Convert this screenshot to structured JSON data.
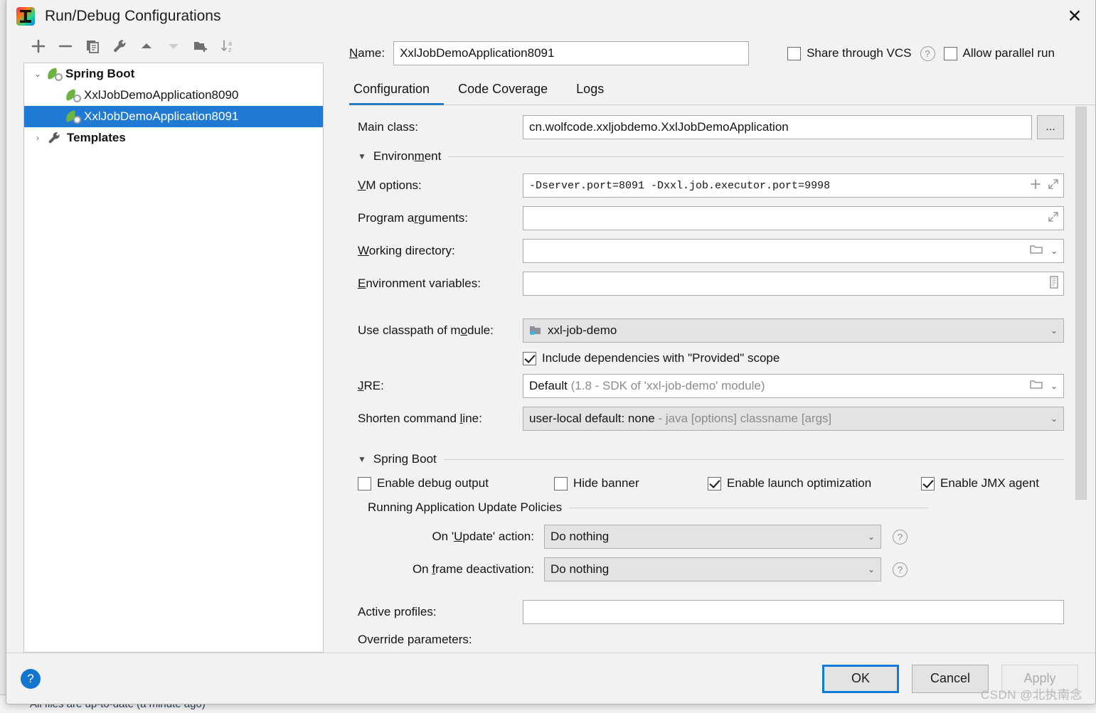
{
  "window": {
    "title": "Run/Debug Configurations",
    "app_icon": "intellij-idea-icon",
    "close_icon": "✕"
  },
  "tree_toolbar": {
    "buttons": [
      {
        "name": "add-configuration-button",
        "icon": "plus-icon",
        "enabled": true
      },
      {
        "name": "remove-configuration-button",
        "icon": "minus-icon",
        "enabled": true
      },
      {
        "name": "copy-configuration-button",
        "icon": "copy-icon",
        "enabled": true
      },
      {
        "name": "edit-templates-button",
        "icon": "wrench-icon",
        "enabled": true
      },
      {
        "name": "move-up-button",
        "icon": "arrow-up-icon",
        "enabled": true
      },
      {
        "name": "move-down-button",
        "icon": "arrow-down-icon",
        "enabled": false
      },
      {
        "name": "new-folder-button",
        "icon": "folder-add-icon",
        "enabled": true
      },
      {
        "name": "sort-alphabetically-button",
        "icon": "sort-az-icon",
        "enabled": true
      }
    ]
  },
  "tree": {
    "nodes": [
      {
        "label": "Spring Boot",
        "icon": "spring-boot-icon",
        "type": "group",
        "expanded": true,
        "twisty": "⌄",
        "selected": false
      },
      {
        "label": "XxlJobDemoApplication8090",
        "icon": "spring-boot-icon",
        "type": "leaf",
        "selected": false
      },
      {
        "label": "XxlJobDemoApplication8091",
        "icon": "spring-boot-icon",
        "type": "leaf",
        "selected": true
      },
      {
        "label": "Templates",
        "icon": "wrench-icon",
        "type": "group",
        "expanded": false,
        "twisty": "›",
        "selected": false
      }
    ]
  },
  "header": {
    "name_label": "Name:",
    "name_value": "XxlJobDemoApplication8091",
    "share_vcs_label": "Share through VCS",
    "share_vcs_checked": false,
    "share_vcs_help": "?",
    "allow_parallel_label": "Allow parallel run",
    "allow_parallel_checked": false
  },
  "tabs": [
    {
      "label": "Configuration",
      "active": true
    },
    {
      "label": "Code Coverage",
      "active": false
    },
    {
      "label": "Logs",
      "active": false
    }
  ],
  "form": {
    "main_class_label": "Main class:",
    "main_class_value": "cn.wolfcode.xxljobdemo.XxlJobDemoApplication",
    "main_class_browse": "...",
    "environment_section": "Environment",
    "vm_options_label": "VM options:",
    "vm_options_value": "-Dserver.port=8091 -Dxxl.job.executor.port=9998",
    "program_arguments_label": "Program arguments:",
    "program_arguments_value": "",
    "working_directory_label": "Working directory:",
    "working_directory_value": "",
    "environment_variables_label": "Environment variables:",
    "environment_variables_value": "",
    "classpath_module_label": "Use classpath of module:",
    "classpath_module_value": "xxl-job-demo",
    "include_provided_label": "Include dependencies with \"Provided\" scope",
    "include_provided_checked": true,
    "jre_label": "JRE:",
    "jre_value": "Default",
    "jre_value_hint": "(1.8 - SDK of 'xxl-job-demo' module)",
    "shorten_cmd_label": "Shorten command line:",
    "shorten_cmd_value": "user-local default: none",
    "shorten_cmd_hint": "- java [options] classname [args]"
  },
  "spring_boot": {
    "section_title": "Spring Boot",
    "checks": [
      {
        "label": "Enable debug output",
        "checked": false,
        "name": "enable-debug-output-checkbox"
      },
      {
        "label": "Hide banner",
        "checked": false,
        "name": "hide-banner-checkbox"
      },
      {
        "label": "Enable launch optimization",
        "checked": true,
        "name": "enable-launch-optimization-checkbox"
      },
      {
        "label": "Enable JMX agent",
        "checked": true,
        "name": "enable-jmx-agent-checkbox"
      }
    ],
    "policies_title": "Running Application Update Policies",
    "on_update_label": "On 'Update' action:",
    "on_update_value": "Do nothing",
    "on_frame_label": "On frame deactivation:",
    "on_frame_value": "Do nothing",
    "help_glyph": "?",
    "active_profiles_label": "Active profiles:",
    "active_profiles_value": "",
    "override_parameters_label": "Override parameters:"
  },
  "footer": {
    "help_glyph": "?",
    "ok_label": "OK",
    "cancel_label": "Cancel",
    "apply_label": "Apply",
    "apply_enabled": false,
    "watermark": "CSDN @北执南念"
  },
  "background": {
    "status_text": "All files are up-to-date (a minute ago)"
  },
  "colors": {
    "accent_blue": "#1f7ad4",
    "tab_underline": "#2a79c6",
    "ok_border": "#1279d4",
    "help_blue": "#1475cf",
    "spring_green": "#6db33f",
    "dialog_bg": "#f2f2f2",
    "field_bg": "#ffffff",
    "combo_bg": "#e3e3e3"
  }
}
